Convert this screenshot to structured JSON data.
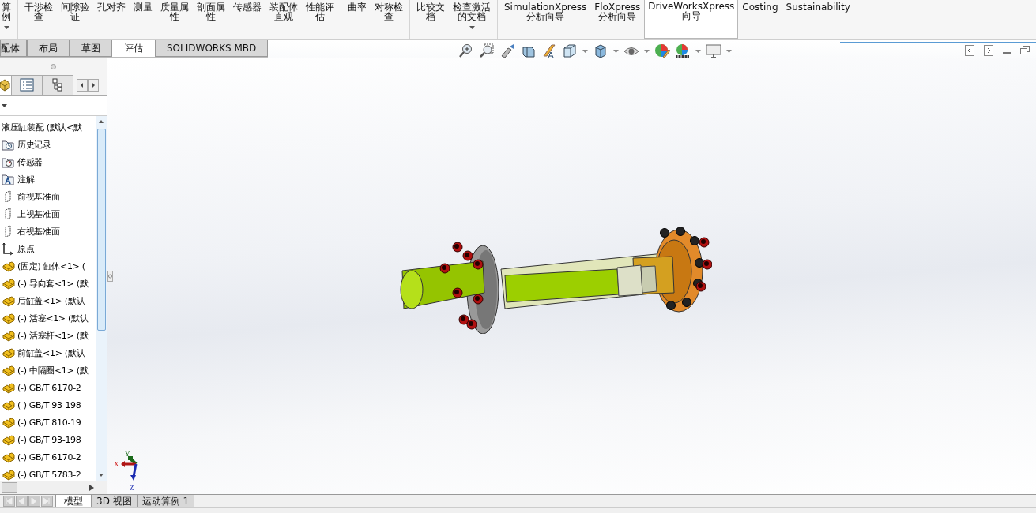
{
  "ribbon": {
    "groups": [
      {
        "items": [
          {
            "lines": [
              "算",
              "例"
            ],
            "dropdown": true,
            "selected": false
          }
        ]
      },
      {
        "items": [
          {
            "lines": [
              "干涉检",
              "查"
            ],
            "dropdown": false,
            "selected": false
          },
          {
            "lines": [
              "间隙验",
              "证"
            ],
            "dropdown": false,
            "selected": false
          },
          {
            "lines": [
              "孔对齐"
            ],
            "dropdown": false,
            "selected": false
          },
          {
            "lines": [
              "测量"
            ],
            "dropdown": false,
            "selected": false
          },
          {
            "lines": [
              "质量属",
              "性"
            ],
            "dropdown": false,
            "selected": false
          },
          {
            "lines": [
              "剖面属",
              "性"
            ],
            "dropdown": false,
            "selected": false
          },
          {
            "lines": [
              "传感器"
            ],
            "dropdown": false,
            "selected": false
          },
          {
            "lines": [
              "装配体",
              "直观"
            ],
            "dropdown": false,
            "selected": false
          },
          {
            "lines": [
              "性能评",
              "估"
            ],
            "dropdown": false,
            "selected": false
          }
        ]
      },
      {
        "items": [
          {
            "lines": [
              "曲率"
            ],
            "dropdown": false,
            "selected": false
          },
          {
            "lines": [
              "对称检",
              "查"
            ],
            "dropdown": false,
            "selected": false
          }
        ]
      },
      {
        "items": [
          {
            "lines": [
              "比较文",
              "档"
            ],
            "dropdown": false,
            "selected": false
          },
          {
            "lines": [
              "检查激活",
              "的文档"
            ],
            "dropdown": true,
            "selected": false
          }
        ]
      },
      {
        "items": [
          {
            "lines": [
              "SimulationXpress",
              "分析向导"
            ],
            "dropdown": false,
            "selected": false
          },
          {
            "lines": [
              "FloXpress",
              "分析向导"
            ],
            "dropdown": false,
            "selected": false
          },
          {
            "lines": [
              "DriveWorksXpress",
              "向导"
            ],
            "dropdown": false,
            "selected": true
          },
          {
            "lines": [
              "Costing"
            ],
            "dropdown": false,
            "selected": false
          },
          {
            "lines": [
              "Sustainability"
            ],
            "dropdown": false,
            "selected": false
          }
        ]
      }
    ]
  },
  "command_tabs": [
    {
      "label": "配体",
      "selected": false
    },
    {
      "label": "布局",
      "selected": false
    },
    {
      "label": "草图",
      "selected": false
    },
    {
      "label": "评估",
      "selected": true
    },
    {
      "label": "SOLIDWORKS MBD",
      "selected": false
    }
  ],
  "panel_tabs": [
    {
      "selected": true
    },
    {
      "selected": false
    },
    {
      "selected": false
    }
  ],
  "feature_tree": {
    "root": {
      "label": "液压缸装配 (默认<默",
      "children": [
        {
          "label": "历史记录",
          "kind": "history"
        },
        {
          "label": "传感器",
          "kind": "sensors"
        },
        {
          "label": "注解",
          "kind": "annotations"
        },
        {
          "label": "前视基准面",
          "kind": "plane"
        },
        {
          "label": "上视基准面",
          "kind": "plane"
        },
        {
          "label": "右视基准面",
          "kind": "plane"
        },
        {
          "label": "原点",
          "kind": "origin"
        },
        {
          "label": "(固定) 缸体<1> (",
          "kind": "part"
        },
        {
          "label": "(-) 导向套<1> (默",
          "kind": "part"
        },
        {
          "label": "后缸盖<1> (默认",
          "kind": "part"
        },
        {
          "label": "(-) 活塞<1> (默认",
          "kind": "part"
        },
        {
          "label": "(-) 活塞杆<1> (默",
          "kind": "part"
        },
        {
          "label": "前缸盖<1> (默认",
          "kind": "part"
        },
        {
          "label": "(-) 中隔圈<1> (默",
          "kind": "part"
        },
        {
          "label": "(-) GB/T 6170-2",
          "kind": "part"
        },
        {
          "label": "(-) GB/T 93-198",
          "kind": "part"
        },
        {
          "label": "(-) GB/T 810-19",
          "kind": "part"
        },
        {
          "label": "(-) GB/T 93-198",
          "kind": "part"
        },
        {
          "label": "(-) GB/T 6170-2",
          "kind": "part"
        },
        {
          "label": "(-) GB/T 5783-2",
          "kind": "part"
        }
      ]
    }
  },
  "triad": {
    "x": "X",
    "y": "Y",
    "z": "Z"
  },
  "bottom_tabs": [
    {
      "label": "模型",
      "selected": true
    },
    {
      "label": "3D 视图",
      "selected": false
    },
    {
      "label": "运动算例 1",
      "selected": false
    }
  ]
}
